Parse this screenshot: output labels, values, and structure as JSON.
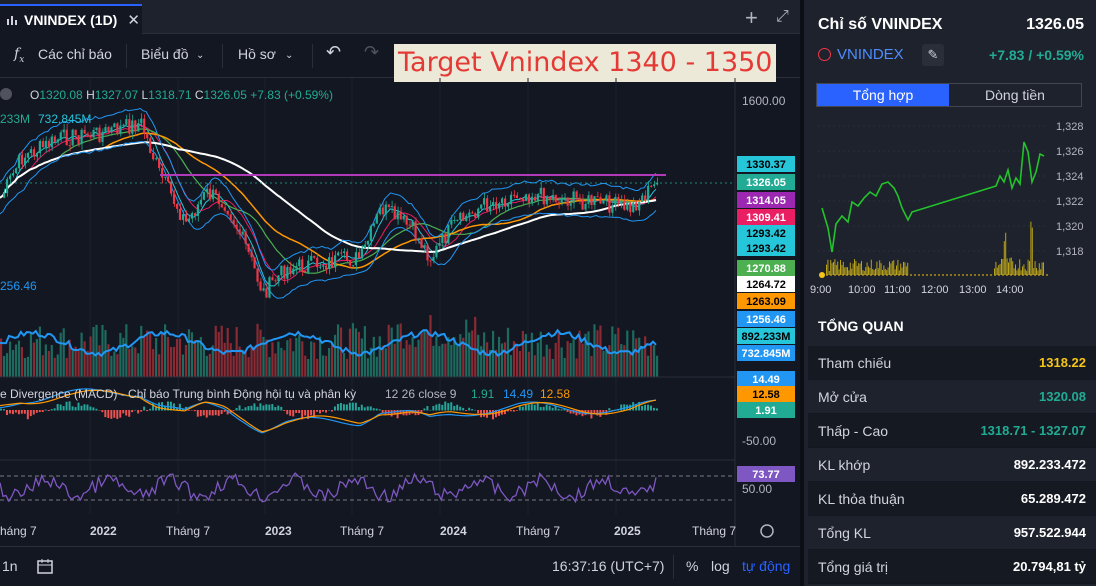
{
  "tab": {
    "title": "VNINDEX (1D)",
    "close": "✕",
    "new_tab": "+",
    "expand": "⤢"
  },
  "toolbar": {
    "indicators": "Các chỉ báo",
    "chart_type": "Biểu đồ",
    "profile": "Hồ sơ",
    "undo": "↶",
    "redo": "↷"
  },
  "annotation": {
    "text": "Target Vnindex 1340 - 1350"
  },
  "legend": {
    "ohlc": [
      {
        "k": "O",
        "v": "1320.08"
      },
      {
        "k": "H",
        "v": "1327.07"
      },
      {
        "k": "L",
        "v": "1318.71"
      },
      {
        "k": "C",
        "v": "1326.05"
      }
    ],
    "change": "+7.83 (+0.59%)",
    "vol_a": "233M",
    "vol_b": "732.845M",
    "left_level": "256.46",
    "macd_label": "e Divergence (MACD) - Chỉ báo Trung bình Động hội tụ và phân kỳ",
    "macd_params": "12 26 close 9",
    "macd_vals": [
      "1.91",
      "14.49",
      "12.58"
    ]
  },
  "axis": {
    "main_top": "1600.00",
    "macd_low": "-50.00",
    "rsi_mid": "50.00",
    "price_tags": [
      {
        "v": "1330.37",
        "bg": "#26c6da",
        "fg": "#000"
      },
      {
        "v": "1326.05",
        "bg": "#22ab94",
        "fg": "#fff"
      },
      {
        "v": "1314.05",
        "bg": "#9c27b0",
        "fg": "#fff"
      },
      {
        "v": "1309.41",
        "bg": "#e91e63",
        "fg": "#fff"
      },
      {
        "v": "1293.42",
        "bg": "#26c6da",
        "fg": "#000"
      },
      {
        "v": "1293.42",
        "bg": "#26c6da",
        "fg": "#000"
      },
      {
        "v": "1270.88",
        "bg": "#4caf50",
        "fg": "#fff"
      },
      {
        "v": "1264.72",
        "bg": "#ffffff",
        "fg": "#000"
      },
      {
        "v": "1263.09",
        "bg": "#ff9800",
        "fg": "#000"
      },
      {
        "v": "1256.46",
        "bg": "#2196f3",
        "fg": "#fff"
      },
      {
        "v": "892.233M",
        "bg": "#26c6da",
        "fg": "#000"
      },
      {
        "v": "732.845M",
        "bg": "#2196f3",
        "fg": "#fff"
      }
    ],
    "macd_tags": [
      {
        "v": "14.49",
        "bg": "#2196f3",
        "fg": "#fff"
      },
      {
        "v": "12.58",
        "bg": "#ff9800",
        "fg": "#000"
      },
      {
        "v": "1.91",
        "bg": "#22ab94",
        "fg": "#fff"
      }
    ],
    "rsi_tag": {
      "v": "73.77",
      "bg": "#7e57c2",
      "fg": "#fff"
    },
    "time_labels": [
      "háng 7",
      "2022",
      "Tháng 7",
      "2023",
      "Tháng 7",
      "2024",
      "Tháng 7",
      "2025",
      "Tháng 7"
    ]
  },
  "status": {
    "interval": "1n",
    "time": "16:37:16 (UTC+7)",
    "pct": "%",
    "log": "log",
    "auto": "tự động"
  },
  "panel": {
    "title": "Chỉ số VNINDEX",
    "price": "1326.05",
    "symbol": "VNINDEX",
    "change": "+7.83 / +0.59%",
    "tabs": [
      "Tổng hợp",
      "Dòng tiền"
    ],
    "mini_y": [
      "1,328",
      "1,326",
      "1,324",
      "1,322",
      "1,320",
      "1,318"
    ],
    "mini_x": [
      "9:00",
      "10:00",
      "11:00",
      "12:00",
      "13:00",
      "14:00"
    ],
    "section": "TỔNG QUAN",
    "rows": [
      {
        "label": "Tham chiếu",
        "value": "1318.22",
        "tone": "yel"
      },
      {
        "label": "Mở cửa",
        "value": "1320.08",
        "tone": "grn"
      },
      {
        "label": "Thấp - Cao",
        "value": "1318.71 - 1327.07",
        "tone": "grn"
      },
      {
        "label": "KL khớp",
        "value": "892.233.472",
        "tone": ""
      },
      {
        "label": "KL thỏa thuận",
        "value": "65.289.472",
        "tone": ""
      },
      {
        "label": "Tổng KL",
        "value": "957.522.944",
        "tone": ""
      },
      {
        "label": "Tổng giá trị",
        "value": "20.794,81 tỷ",
        "tone": ""
      }
    ]
  },
  "colors": {
    "up": "#22ab94",
    "down": "#f23645",
    "target_line": "#b03ab8",
    "panel_bg": "#1e222d"
  }
}
